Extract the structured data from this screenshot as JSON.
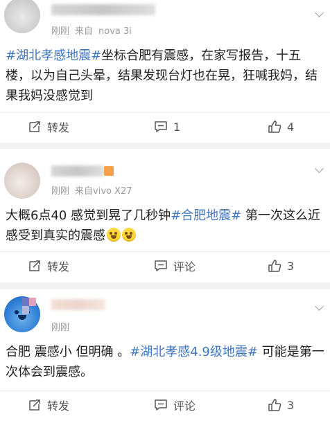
{
  "posts": [
    {
      "time": "刚刚",
      "source": "来自",
      "device": "nova 3i",
      "content": [
        {
          "type": "tag",
          "text": "#湖北孝感地震#"
        },
        {
          "type": "text",
          "text": "坐标合肥有震感，在家写报告，十五楼，以为自己头晕，结果发现台灯也在晃，狂喊我妈，结果我妈没感觉到"
        }
      ],
      "actions": {
        "repost": "转发",
        "comment": "1",
        "like": "4"
      }
    },
    {
      "time": "刚刚",
      "source": "来自",
      "device": "vivo X27",
      "content": [
        {
          "type": "text",
          "text": "大概6点40 感觉到晃了几秒钟"
        },
        {
          "type": "tag",
          "text": "#合肥地震#"
        },
        {
          "type": "text",
          "text": " 第一次这么近感受到真实的震感"
        }
      ],
      "actions": {
        "repost": "转发",
        "comment": "评论",
        "like": "3"
      }
    },
    {
      "time": "刚刚",
      "source": "",
      "device": "",
      "content": [
        {
          "type": "text",
          "text": "合肥 震感小 但明确 。"
        },
        {
          "type": "tag",
          "text": "#湖北孝感4.9级地震#"
        },
        {
          "type": "text",
          "text": " 可能是第一次体会到震感。"
        }
      ],
      "actions": {
        "repost": "转发",
        "comment": "评论",
        "like": "3"
      }
    }
  ],
  "icons": {
    "repost": "repost-icon",
    "comment": "comment-icon",
    "like": "thumbs-up-icon",
    "menu": "chevron-down-icon"
  },
  "colors": {
    "topic_link": "#3e76c2",
    "feed_background": "#f2f2f2",
    "card_background": "#ffffff"
  }
}
